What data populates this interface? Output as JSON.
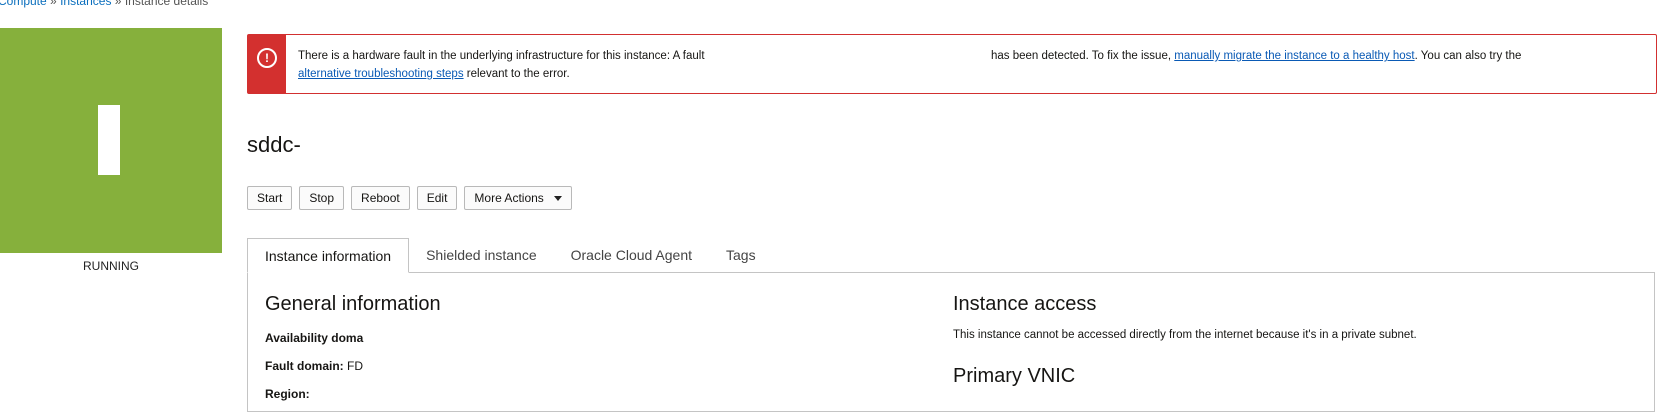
{
  "breadcrumb": {
    "items": [
      "Compute",
      "Instances",
      "Instance details"
    ],
    "separator": "»"
  },
  "instance": {
    "status": "RUNNING",
    "status_color": "#86b03c",
    "name": "sddc-"
  },
  "alert": {
    "color": "#d3302f",
    "icon": "exclamation-circle-icon",
    "text_start": "There is a hardware fault in the underlying infrastructure for this instance: A fault",
    "text_mid": "has been detected. To fix the issue,",
    "link1": "manually migrate the instance to a healthy host",
    "text_after_link1": ". You can also try the",
    "link2": "alternative troubleshooting steps",
    "text_end": "relevant to the error."
  },
  "actions": {
    "start": "Start",
    "stop": "Stop",
    "reboot": "Reboot",
    "edit": "Edit",
    "more": "More Actions"
  },
  "tabs": [
    {
      "label": "Instance information",
      "active": true
    },
    {
      "label": "Shielded instance",
      "active": false
    },
    {
      "label": "Oracle Cloud Agent",
      "active": false
    },
    {
      "label": "Tags",
      "active": false
    }
  ],
  "general": {
    "title": "General information",
    "availability_domain_label": "Availability doma",
    "fault_domain_label": "Fault domain:",
    "fault_domain_value": "FD",
    "region_label": "Region:"
  },
  "access": {
    "title": "Instance access",
    "description": "This instance cannot be accessed directly from the internet because it's in a private subnet.",
    "vnic_title": "Primary VNIC"
  }
}
